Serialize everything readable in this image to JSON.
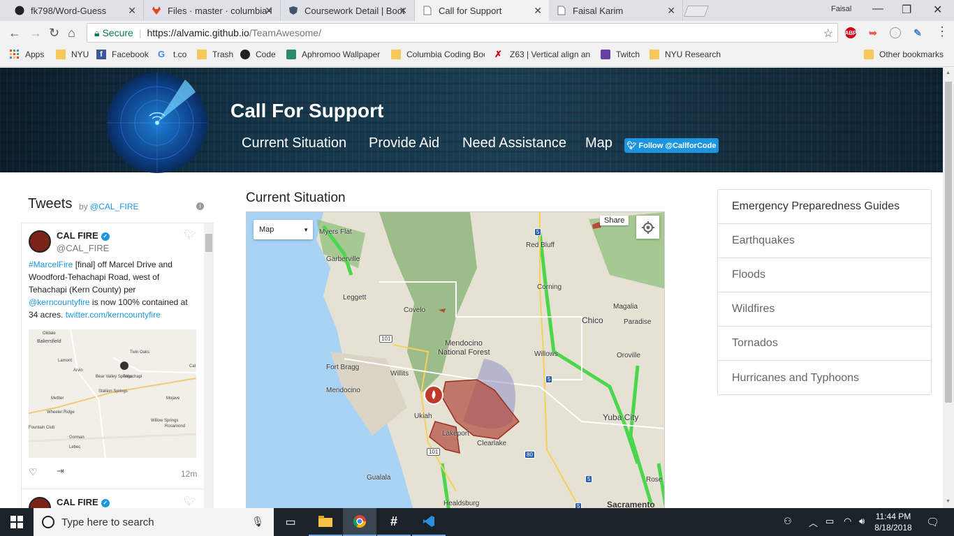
{
  "browser": {
    "tabs": [
      {
        "title": "fk798/Word-Guess",
        "active": false
      },
      {
        "title": "Files · master · columbia-l",
        "active": false
      },
      {
        "title": "Coursework Detail | Boot",
        "active": false
      },
      {
        "title": "Call for Support",
        "active": true
      },
      {
        "title": "Faisal Karim",
        "active": false
      }
    ],
    "profile_name": "Faisal",
    "secure_label": "Secure",
    "url_host": "https://alvamic.github.io",
    "url_path": "/TeamAwesome/",
    "extensions": [
      "ABP"
    ],
    "bookmarks": [
      {
        "label": "Apps",
        "icon": "apps-grid-icon"
      },
      {
        "label": "NYU",
        "icon": "folder-icon"
      },
      {
        "label": "Facebook",
        "icon": "facebook-icon"
      },
      {
        "label": "t.co",
        "icon": "google-icon"
      },
      {
        "label": "Trash",
        "icon": "folder-icon"
      },
      {
        "label": "Code",
        "icon": "github-icon"
      },
      {
        "label": "Aphromoo Wallpaper",
        "icon": "image-icon"
      },
      {
        "label": "Columbia Coding Boo",
        "icon": "folder-icon"
      },
      {
        "label": "Z63 | Vertical align an",
        "icon": "z63-icon"
      },
      {
        "label": "Twitch",
        "icon": "twitch-icon"
      },
      {
        "label": "NYU Research",
        "icon": "folder-icon"
      }
    ],
    "other_bookmarks": "Other bookmarks"
  },
  "site": {
    "title": "Call For Support",
    "nav": [
      "Current Situation",
      "Provide Aid",
      "Need Assistance",
      "Map"
    ],
    "follow_button": "Follow @CallforCode"
  },
  "tweets": {
    "header": "Tweets",
    "by_label": "by",
    "by_handle": "@CAL_FIRE",
    "items": [
      {
        "name": "CAL FIRE",
        "handle": "@CAL_FIRE",
        "text_parts": [
          {
            "t": "#MarcelFire",
            "link": true
          },
          {
            "t": " [final] off Marcel Drive and Woodford-Tehachapi Road, west of Tehachapi (Kern County) per ",
            "link": false
          },
          {
            "t": "@kerncountyfire",
            "link": true
          },
          {
            "t": " is now 100% contained at 34 acres. ",
            "link": false
          },
          {
            "t": "twitter.com/kerncountyfire",
            "link": true
          }
        ],
        "map_labels": [
          "Oildale",
          "Bakersfield",
          "Twin Oaks",
          "Lamont",
          "Arvin",
          "Bear Valley Springs",
          "Tehachapi",
          "Stallion Springs",
          "Mettler",
          "Wheeler Ridge",
          "Mojave",
          "Willow Springs",
          "Rosamond",
          "Gorman",
          "Lebec",
          "Cal",
          "Fountain Club"
        ],
        "time": "12m"
      },
      {
        "name": "CAL FIRE"
      }
    ]
  },
  "current_situation": {
    "title": "Current Situation",
    "map": {
      "type_selected": "Map",
      "share_label": "Share",
      "places": [
        "Myers Flat",
        "Garberville",
        "Red Bluff",
        "Leggett",
        "Corning",
        "Covelo",
        "Magalia",
        "Chico",
        "Paradise",
        "Mendocino",
        "National Forest",
        "Willows",
        "Oroville",
        "Fort Bragg",
        "Willits",
        "Mendocino",
        "Ukiah",
        "Yuba City",
        "Lakeport",
        "Clearlake",
        "Rose",
        "Gualala",
        "Healdsburg",
        "Sacramento"
      ],
      "route_shields": [
        "5",
        "101",
        "5",
        "101",
        "5",
        "80",
        "5"
      ]
    }
  },
  "guides": [
    "Emergency Preparedness Guides",
    "Earthquakes",
    "Floods",
    "Wildfires",
    "Tornados",
    "Hurricanes and Typhoons"
  ],
  "taskbar": {
    "search_placeholder": "Type here to search",
    "time": "11:44 PM",
    "date": "8/18/2018"
  },
  "colors": {
    "accent_twitter": "#1b95e0",
    "secure_green": "#0b8043",
    "fire_red": "#c0392b"
  }
}
